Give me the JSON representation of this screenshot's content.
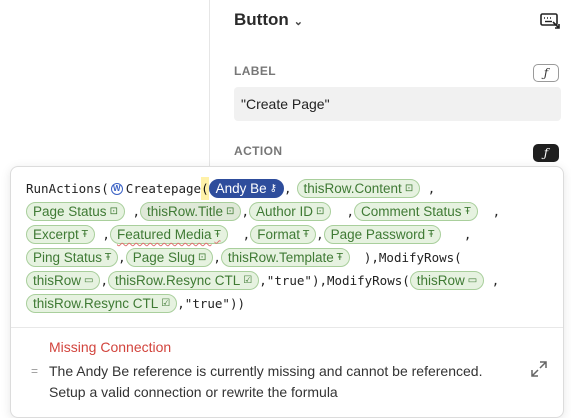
{
  "panel": {
    "title": "Button",
    "chevron": "chevron-down-icon",
    "top_icon": "keyboard-icon"
  },
  "label_section": {
    "heading": "LABEL",
    "fx": "ƒ",
    "value": "\"Create Page\""
  },
  "action_section": {
    "heading": "ACTION",
    "fx": "ƒ"
  },
  "formula": {
    "line1": {
      "t1": "RunActions(",
      "t2": "Createpage",
      "open": "(",
      "pill_user": "Andy Be",
      "comma": ",",
      "pill_content": "thisRow.Content"
    },
    "pills_line2": [
      "Page Status",
      "thisRow.Title",
      "Author ID",
      "Comment Status"
    ],
    "pills_line3": [
      "Excerpt",
      "Featured Media",
      "Format",
      "Page Password"
    ],
    "pills_line4": [
      "Ping Status",
      "Page Slug",
      "thisRow.Template"
    ],
    "line4_tail": "),ModifyRows(",
    "line5": {
      "pill_row": "thisRow",
      "pill_resync": "thisRow.Resync CTL",
      "text": ",\"true\"),ModifyRows(",
      "pill_row2": "thisRow"
    },
    "line6": {
      "pill_resync": "thisRow.Resync CTL",
      "text": ",\"true\"))"
    }
  },
  "error": {
    "title": "Missing Connection",
    "message": "The Andy Be reference is currently missing and cannot be referenced. Setup a valid connection or rewrite the formula"
  },
  "colors": {
    "pill_bg": "#e6f2e0",
    "pill_text": "#3f7a34",
    "user_pill": "#2e4d9c",
    "error": "#d2443d"
  }
}
